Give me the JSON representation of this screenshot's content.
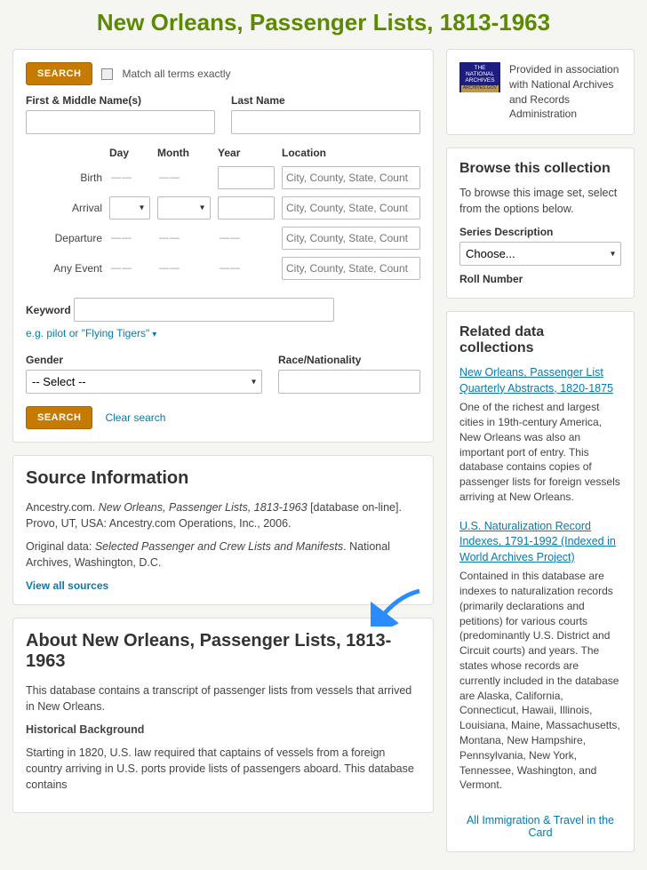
{
  "title": "New Orleans, Passenger Lists, 1813-1963",
  "search": {
    "button": "SEARCH",
    "match_all": "Match all terms exactly",
    "first_label": "First & Middle Name(s)",
    "last_label": "Last Name",
    "day": "Day",
    "month": "Month",
    "year": "Year",
    "location": "Location",
    "birth": "Birth",
    "arrival": "Arrival",
    "departure": "Departure",
    "any_event": "Any Event",
    "loc_ph": "City, County, State, Count",
    "keyword": "Keyword",
    "eg": "e.g. pilot or \"Flying Tigers\"",
    "gender": "Gender",
    "gender_sel": "-- Select --",
    "race": "Race/Nationality",
    "clear": "Clear search"
  },
  "source": {
    "heading": "Source Information",
    "line1a": "Ancestry.com. ",
    "line1b": "New Orleans, Passenger Lists, 1813-1963",
    "line1c": " [database on-line]. Provo, UT, USA: Ancestry.com Operations, Inc., 2006.",
    "line2a": "Original data: ",
    "line2b": "Selected Passenger and Crew Lists and Manifests",
    "line2c": ". National Archives, Washington, D.C.",
    "view_all": "View all sources"
  },
  "about": {
    "heading": "About New Orleans, Passenger Lists, 1813-1963",
    "p1": "This database contains a transcript of passenger lists from vessels that arrived in New Orleans.",
    "hb": "Historical Background",
    "p2": "Starting in 1820, U.S. law required that captains of vessels from a foreign country arriving in U.S. ports provide lists of passengers aboard. This database contains"
  },
  "assoc": {
    "badge_l1": "THE",
    "badge_l2": "NATIONAL",
    "badge_l3": "ARCHIVES",
    "badge_bar": "ARCHIVES.GOV",
    "text": "Provided in association with National Archives and Records Administration"
  },
  "browse": {
    "heading": "Browse this collection",
    "text": "To browse this image set, select from the options below.",
    "series": "Series Description",
    "choose": "Choose...",
    "roll": "Roll Number"
  },
  "related": {
    "heading": "Related data collections",
    "r1_title": "New Orleans, Passenger List Quarterly Abstracts, 1820-1875",
    "r1_desc": "One of the richest and largest cities in 19th-century America, New Orleans was also an important port of entry. This database contains copies of passenger lists for foreign vessels arriving at New Orleans.",
    "r2_title": "U.S. Naturalization Record Indexes, 1791-1992 (Indexed in World Archives Project)",
    "r2_desc": "Contained in this database are indexes to naturalization records (primarily declarations and petitions) for various courts (predominantly U.S. District and Circuit courts) and years. The states whose records are currently included in the database are Alaska, California, Connecticut, Hawaii, Illinois, Louisiana, Maine, Massachusetts, Montana, New Hampshire, Pennsylvania, New York, Tennessee, Washington, and Vermont.",
    "all": "All Immigration & Travel in the Card"
  }
}
